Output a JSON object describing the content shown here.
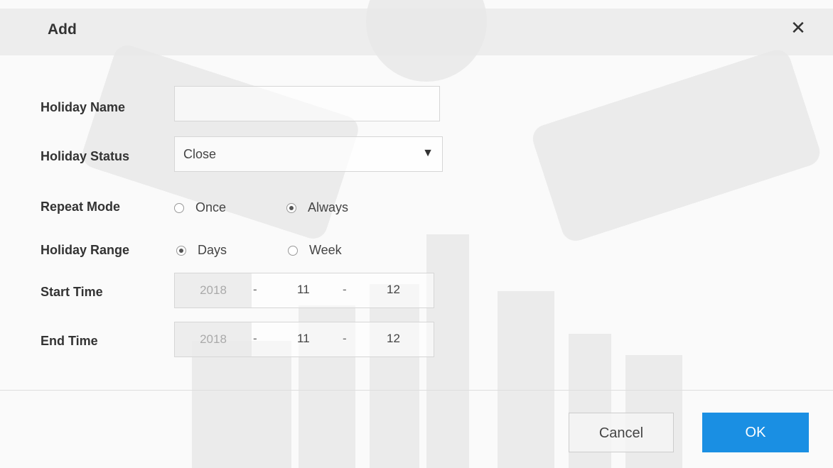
{
  "dialog": {
    "title": "Add",
    "close_icon": "close-icon"
  },
  "form": {
    "holiday_name": {
      "label": "Holiday Name",
      "value": "",
      "placeholder": ""
    },
    "holiday_status": {
      "label": "Holiday Status",
      "selected": "Close",
      "arrow": "▼"
    },
    "repeat_mode": {
      "label": "Repeat Mode",
      "options": [
        "Once",
        "Always"
      ],
      "selected": "Always"
    },
    "holiday_range": {
      "label": "Holiday Range",
      "options": [
        "Days",
        "Week"
      ],
      "selected": "Days"
    },
    "start_time": {
      "label": "Start Time",
      "year": "2018",
      "sep": "-",
      "month": "11",
      "day": "12"
    },
    "end_time": {
      "label": "End Time",
      "year": "2018",
      "sep": "-",
      "month": "11",
      "day": "12"
    }
  },
  "buttons": {
    "cancel": "Cancel",
    "ok": "OK"
  },
  "colors": {
    "primary": "#1a8fe3",
    "titlebar": "#e8e8e8"
  }
}
